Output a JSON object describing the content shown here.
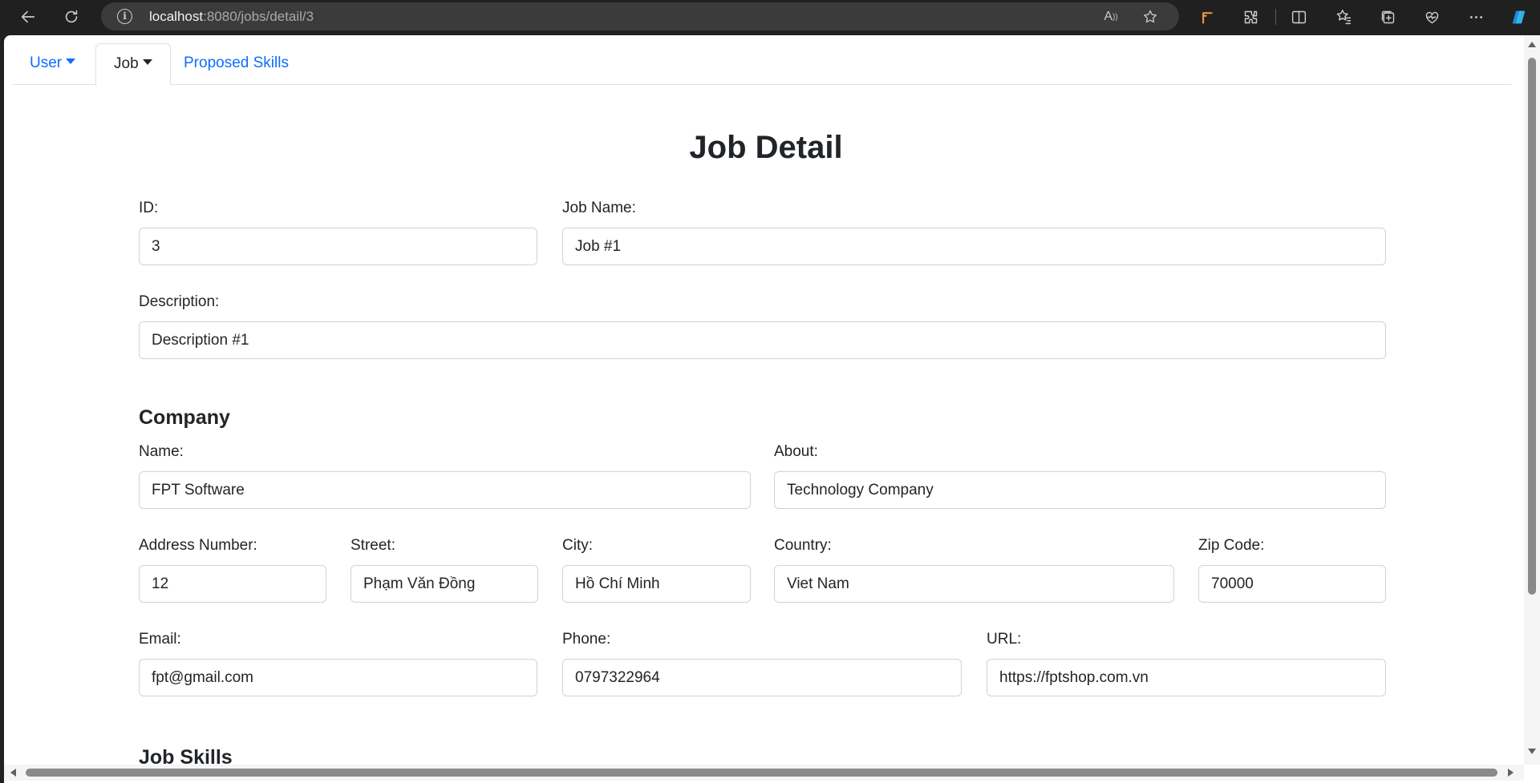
{
  "browser": {
    "url_host": "localhost",
    "url_rest": ":8080/jobs/detail/3"
  },
  "tabs": [
    {
      "label": "User",
      "dropdown": true
    },
    {
      "label": "Job",
      "dropdown": true,
      "active": true
    },
    {
      "label": "Proposed Skills",
      "dropdown": false
    }
  ],
  "page": {
    "title": "Job Detail",
    "job": {
      "id_label": "ID:",
      "id_value": "3",
      "name_label": "Job Name:",
      "name_value": "Job #1",
      "description_label": "Description:",
      "description_value": "Description #1"
    },
    "company": {
      "heading": "Company",
      "name_label": "Name:",
      "name_value": "FPT Software",
      "about_label": "About:",
      "about_value": "Technology Company",
      "address_number_label": "Address Number:",
      "address_number_value": "12",
      "street_label": "Street:",
      "street_value": "Phạm Văn Đồng",
      "city_label": "City:",
      "city_value": "Hồ Chí Minh",
      "country_label": "Country:",
      "country_value": "Viet Nam",
      "zip_label": "Zip Code:",
      "zip_value": "70000",
      "email_label": "Email:",
      "email_value": "fpt@gmail.com",
      "phone_label": "Phone:",
      "phone_value": "0797322964",
      "url_label": "URL:",
      "url_value": "https://fptshop.com.vn"
    },
    "skills_heading": "Job Skills"
  },
  "colors": {
    "link": "#0d6efd",
    "text": "#212529",
    "border": "#ced4da"
  }
}
